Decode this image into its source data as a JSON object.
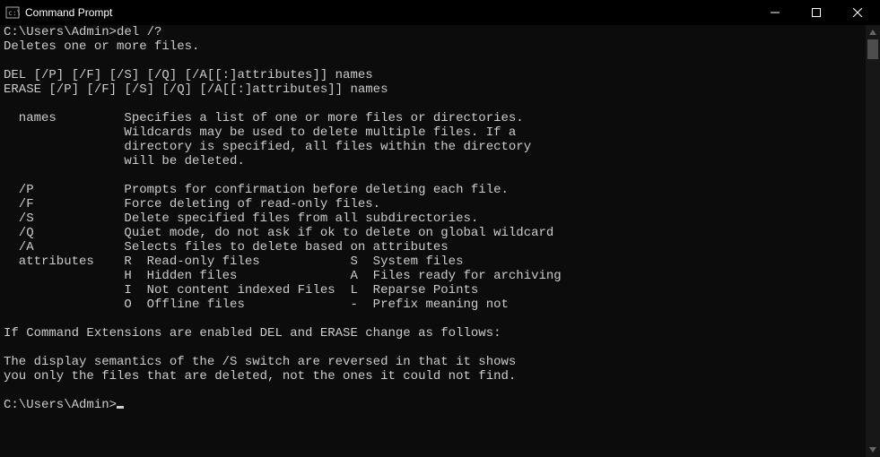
{
  "window": {
    "title": "Command Prompt"
  },
  "terminal": {
    "prompt1": "C:\\Users\\Admin>",
    "cmd1": "del /?",
    "output": "Deletes one or more files.\n\nDEL [/P] [/F] [/S] [/Q] [/A[[:]attributes]] names\nERASE [/P] [/F] [/S] [/Q] [/A[[:]attributes]] names\n\n  names         Specifies a list of one or more files or directories.\n                Wildcards may be used to delete multiple files. If a\n                directory is specified, all files within the directory\n                will be deleted.\n\n  /P            Prompts for confirmation before deleting each file.\n  /F            Force deleting of read-only files.\n  /S            Delete specified files from all subdirectories.\n  /Q            Quiet mode, do not ask if ok to delete on global wildcard\n  /A            Selects files to delete based on attributes\n  attributes    R  Read-only files            S  System files\n                H  Hidden files               A  Files ready for archiving\n                I  Not content indexed Files  L  Reparse Points\n                O  Offline files              -  Prefix meaning not\n\nIf Command Extensions are enabled DEL and ERASE change as follows:\n\nThe display semantics of the /S switch are reversed in that it shows\nyou only the files that are deleted, not the ones it could not find.\n",
    "prompt2": "C:\\Users\\Admin>"
  }
}
